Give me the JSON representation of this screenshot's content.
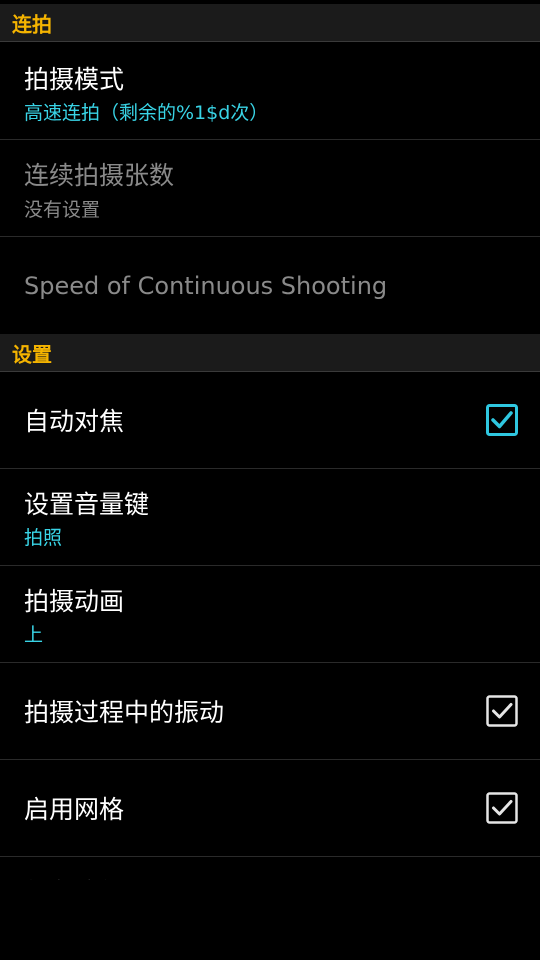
{
  "sections": {
    "burst": {
      "header": "连拍"
    },
    "settings": {
      "header": "设置"
    }
  },
  "items": {
    "shooting_mode": {
      "title": "拍摄模式",
      "summary": "高速连拍（剩余的%1$d次）"
    },
    "burst_count": {
      "title": "连续拍摄张数",
      "summary": "没有设置"
    },
    "burst_speed": {
      "title": "Speed of Continuous Shooting"
    },
    "autofocus": {
      "title": "自动对焦",
      "checked": true
    },
    "volume_key": {
      "title": "设置音量键",
      "summary": "拍照"
    },
    "shot_animation": {
      "title": "拍摄动画",
      "summary": "上"
    },
    "vibration": {
      "title": "拍摄过程中的振动",
      "checked": true
    },
    "grid": {
      "title": "启用网格",
      "checked": true
    },
    "save_path": {
      "title": "保存路径"
    }
  },
  "colors": {
    "section_header_text": "#f5b400",
    "summary_text": "#39d4e6",
    "accent_checkbox": "#2fc7e0"
  },
  "icons": {
    "checkbox_checked": "checkbox-checked-icon"
  }
}
